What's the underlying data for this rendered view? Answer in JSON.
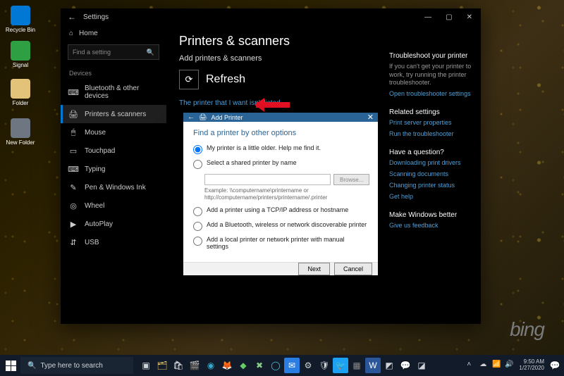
{
  "desktop": {
    "watermark": "bing",
    "icons": [
      {
        "label": "Recycle Bin"
      },
      {
        "label": "Signal"
      },
      {
        "label": "Folder"
      },
      {
        "label": "New Folder"
      }
    ]
  },
  "settings": {
    "title": "Settings",
    "home": "Home",
    "search_placeholder": "Find a setting",
    "category": "Devices",
    "nav": [
      {
        "icon": "⌨",
        "label": "Bluetooth & other devices"
      },
      {
        "icon": "🖨",
        "label": "Printers & scanners"
      },
      {
        "icon": "🖱",
        "label": "Mouse"
      },
      {
        "icon": "▭",
        "label": "Touchpad"
      },
      {
        "icon": "⌨",
        "label": "Typing"
      },
      {
        "icon": "✎",
        "label": "Pen & Windows Ink"
      },
      {
        "icon": "◎",
        "label": "Wheel"
      },
      {
        "icon": "▶",
        "label": "AutoPlay"
      },
      {
        "icon": "⇵",
        "label": "USB"
      }
    ],
    "active_index": 1,
    "page": {
      "heading": "Printers & scanners",
      "subheading": "Add printers & scanners",
      "refresh": "Refresh",
      "link": "The printer that I want isn't listed"
    },
    "right": {
      "troubleshoot": {
        "head": "Troubleshoot your printer",
        "text": "If you can't get your printer to work, try running the printer troubleshooter.",
        "link": "Open troubleshooter settings"
      },
      "related": {
        "head": "Related settings",
        "links": [
          "Print server properties",
          "Run the troubleshooter"
        ]
      },
      "question": {
        "head": "Have a question?",
        "links": [
          "Downloading print drivers",
          "Scanning documents",
          "Changing printer status",
          "Get help"
        ]
      },
      "better": {
        "head": "Make Windows better",
        "link": "Give us feedback"
      }
    }
  },
  "dialog": {
    "title": "Add Printer",
    "heading": "Find a printer by other options",
    "options": [
      "My printer is a little older. Help me find it.",
      "Select a shared printer by name",
      "Add a printer using a TCP/IP address or hostname",
      "Add a Bluetooth, wireless or network discoverable printer",
      "Add a local printer or network printer with manual settings"
    ],
    "selected_index": 0,
    "browse": "Browse...",
    "example": "Example: \\\\computername\\printername or http://computername/printers/printername/.printer",
    "next": "Next",
    "cancel": "Cancel"
  },
  "taskbar": {
    "search": "Type here to search",
    "time": "9:50 AM",
    "date": "1/27/2020",
    "apps": [
      {
        "name": "task-view",
        "glyph": "▣",
        "bg": "",
        "fg": "#cfd3d8"
      },
      {
        "name": "file-explorer",
        "glyph": "🗂",
        "bg": "",
        "fg": "#e8c56a"
      },
      {
        "name": "store",
        "glyph": "🛍",
        "bg": "",
        "fg": "#fff"
      },
      {
        "name": "movies",
        "glyph": "🎬",
        "bg": "",
        "fg": "#e55"
      },
      {
        "name": "edge",
        "glyph": "◉",
        "bg": "",
        "fg": "#3ac"
      },
      {
        "name": "browser",
        "glyph": "🦊",
        "bg": "",
        "fg": "#e70"
      },
      {
        "name": "app1",
        "glyph": "◆",
        "bg": "",
        "fg": "#6c6"
      },
      {
        "name": "xbox",
        "glyph": "✖",
        "bg": "",
        "fg": "#8c8"
      },
      {
        "name": "cortana",
        "glyph": "◯",
        "bg": "",
        "fg": "#5bd"
      },
      {
        "name": "mail",
        "glyph": "✉",
        "bg": "#2a7de1",
        "fg": "#fff"
      },
      {
        "name": "settings",
        "glyph": "⚙",
        "bg": "",
        "fg": "#cfd3d8"
      },
      {
        "name": "security",
        "glyph": "🛡",
        "bg": "",
        "fg": "#cfd3d8"
      },
      {
        "name": "twitter",
        "glyph": "🐦",
        "bg": "#1da1f2",
        "fg": "#fff"
      },
      {
        "name": "app2",
        "glyph": "▦",
        "bg": "",
        "fg": "#888"
      },
      {
        "name": "word",
        "glyph": "W",
        "bg": "#2b579a",
        "fg": "#fff"
      },
      {
        "name": "app3",
        "glyph": "◩",
        "bg": "",
        "fg": "#cfd3d8"
      },
      {
        "name": "chat",
        "glyph": "💬",
        "bg": "",
        "fg": "#cfd3d8"
      },
      {
        "name": "app4",
        "glyph": "◪",
        "bg": "",
        "fg": "#cfd3d8"
      }
    ],
    "tray": [
      {
        "name": "chevron",
        "glyph": "˄"
      },
      {
        "name": "onedrive",
        "glyph": "☁"
      },
      {
        "name": "wifi",
        "glyph": "📶"
      },
      {
        "name": "volume",
        "glyph": "🔊"
      }
    ]
  }
}
